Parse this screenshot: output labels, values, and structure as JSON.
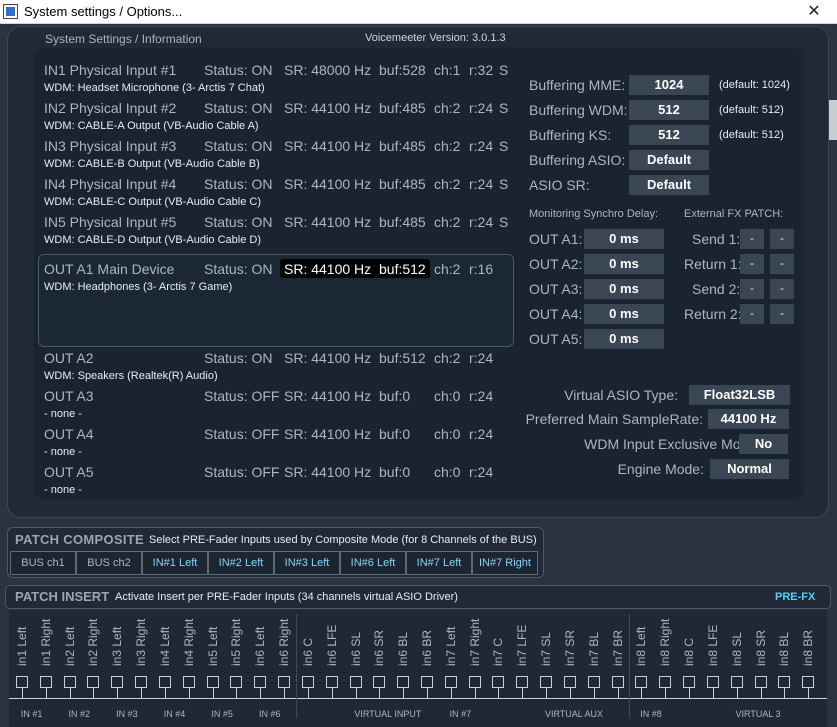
{
  "window": {
    "title": "System settings / Options...",
    "close_glyph": "✕"
  },
  "header": {
    "label": "System Settings / Information",
    "version": "Voicemeeter Version: 3.0.1.3"
  },
  "devices": [
    {
      "name": "IN1 Physical Input #1",
      "status": "Status: ON",
      "sr": "SR: 48000 Hz",
      "buf": "buf:528",
      "ch": "ch:1",
      "r": "r:32",
      "s": "S",
      "driver": "WDM: Headset Microphone (3- Arctis 7 Chat)"
    },
    {
      "name": "IN2 Physical Input #2",
      "status": "Status: ON",
      "sr": "SR: 44100 Hz",
      "buf": "buf:485",
      "ch": "ch:2",
      "r": "r:24",
      "s": "S",
      "driver": "WDM: CABLE-A Output (VB-Audio Cable A)"
    },
    {
      "name": "IN3 Physical Input #3",
      "status": "Status: ON",
      "sr": "SR: 44100 Hz",
      "buf": "buf:485",
      "ch": "ch:2",
      "r": "r:24",
      "s": "S",
      "driver": "WDM: CABLE-B Output (VB-Audio Cable B)"
    },
    {
      "name": "IN4 Physical Input #4",
      "status": "Status: ON",
      "sr": "SR: 44100 Hz",
      "buf": "buf:485",
      "ch": "ch:2",
      "r": "r:24",
      "s": "S",
      "driver": "WDM: CABLE-C Output (VB-Audio Cable C)"
    },
    {
      "name": "IN5 Physical Input #5",
      "status": "Status: ON",
      "sr": "SR: 44100 Hz",
      "buf": "buf:485",
      "ch": "ch:2",
      "r": "r:24",
      "s": "S",
      "driver": "WDM: CABLE-D Output (VB-Audio Cable D)"
    },
    {
      "name": "OUT A1 Main Device",
      "status": "Status: ON",
      "sr": "SR: 44100 Hz",
      "buf": "buf:512",
      "ch": "ch:2",
      "r": "r:16",
      "s": "",
      "driver": "WDM: Headphones (3- Arctis 7 Game)"
    },
    {
      "name": "OUT A2",
      "status": "Status: ON",
      "sr": "SR: 44100 Hz",
      "buf": "buf:512",
      "ch": "ch:2",
      "r": "r:24",
      "s": "",
      "driver": "WDM: Speakers (Realtek(R) Audio)"
    },
    {
      "name": "OUT A3",
      "status": "Status: OFF",
      "sr": "SR: 44100 Hz",
      "buf": "buf:0",
      "ch": "ch:0",
      "r": "r:24",
      "s": "",
      "driver": "- none -"
    },
    {
      "name": "OUT A4",
      "status": "Status: OFF",
      "sr": "SR: 44100 Hz",
      "buf": "buf:0",
      "ch": "ch:0",
      "r": "r:24",
      "s": "",
      "driver": "- none -"
    },
    {
      "name": "OUT A5",
      "status": "Status: OFF",
      "sr": "SR: 44100 Hz",
      "buf": "buf:0",
      "ch": "ch:0",
      "r": "r:24",
      "s": "",
      "driver": "- none -"
    }
  ],
  "buffering": [
    {
      "label": "Buffering MME:",
      "value": "1024",
      "default": "(default: 1024)"
    },
    {
      "label": "Buffering WDM:",
      "value": "512",
      "default": "(default: 512)"
    },
    {
      "label": "Buffering KS:",
      "value": "512",
      "default": "(default: 512)"
    },
    {
      "label": "Buffering ASIO:",
      "value": "Default",
      "default": ""
    },
    {
      "label": "ASIO SR:",
      "value": "Default",
      "default": ""
    }
  ],
  "monitoring": {
    "title": "Monitoring Synchro Delay:",
    "rows": [
      {
        "label": "OUT A1:",
        "value": "0 ms"
      },
      {
        "label": "OUT A2:",
        "value": "0 ms"
      },
      {
        "label": "OUT A3:",
        "value": "0 ms"
      },
      {
        "label": "OUT A4:",
        "value": "0 ms"
      },
      {
        "label": "OUT A5:",
        "value": "0 ms"
      }
    ]
  },
  "fx_patch": {
    "title": "External FX PATCH:",
    "rows": [
      {
        "label": "Send 1:",
        "a": "-",
        "b": "-"
      },
      {
        "label": "Return 1:",
        "a": "-",
        "b": "-"
      },
      {
        "label": "Send 2:",
        "a": "-",
        "b": "-"
      },
      {
        "label": "Return 2:",
        "a": "-",
        "b": "-"
      }
    ]
  },
  "engine": [
    {
      "label": "Virtual ASIO Type:",
      "value": "Float32LSB"
    },
    {
      "label": "Preferred Main SampleRate:",
      "value": "44100 Hz"
    },
    {
      "label": "WDM Input Exclusive Mode:",
      "value": "No"
    },
    {
      "label": "Engine Mode:",
      "value": "Normal"
    }
  ],
  "patch_composite": {
    "title": "PATCH COMPOSITE",
    "desc": "Select PRE-Fader Inputs used by Composite Mode (for 8 Channels of the BUS)",
    "buttons": [
      "BUS ch1",
      "BUS ch2",
      "IN#1 Left",
      "IN#2 Left",
      "IN#3 Left",
      "IN#6 Left",
      "IN#7 Left",
      "IN#7 Right"
    ]
  },
  "patch_insert": {
    "title": "PATCH INSERT",
    "desc": "Activate Insert per PRE-Fader Inputs (34 channels virtual ASIO Driver)",
    "mode": "PRE-FX",
    "channels": [
      "in1 Left",
      "in1 Right",
      "in2 Left",
      "in2 Right",
      "in3 Left",
      "in3 Right",
      "in4 Left",
      "in4 Right",
      "in5 Left",
      "in5 Right",
      "in6 Left",
      "in6 Right",
      "in6 C",
      "in6 LFE",
      "in6 SL",
      "in6 SR",
      "in6 BL",
      "in6 BR",
      "in7 Left",
      "in7 Right",
      "in7 C",
      "in7 LFE",
      "in7 SL",
      "in7 SR",
      "in7 BL",
      "in7 BR",
      "in8 Left",
      "in8 Right",
      "in8 C",
      "in8 LFE",
      "in8 SL",
      "in8 SR",
      "in8 BL",
      "in8 BR"
    ],
    "groups": [
      "IN #1",
      "IN #2",
      "IN #3",
      "IN #4",
      "IN #5",
      "IN #6",
      "VIRTUAL INPUT",
      "IN #7",
      "VIRTUAL AUX",
      "IN #8",
      "VIRTUAL 3"
    ]
  },
  "colors": {
    "accent": "#4fd2ff",
    "panel": "#1f2a36",
    "value_box": "#3a4654"
  }
}
